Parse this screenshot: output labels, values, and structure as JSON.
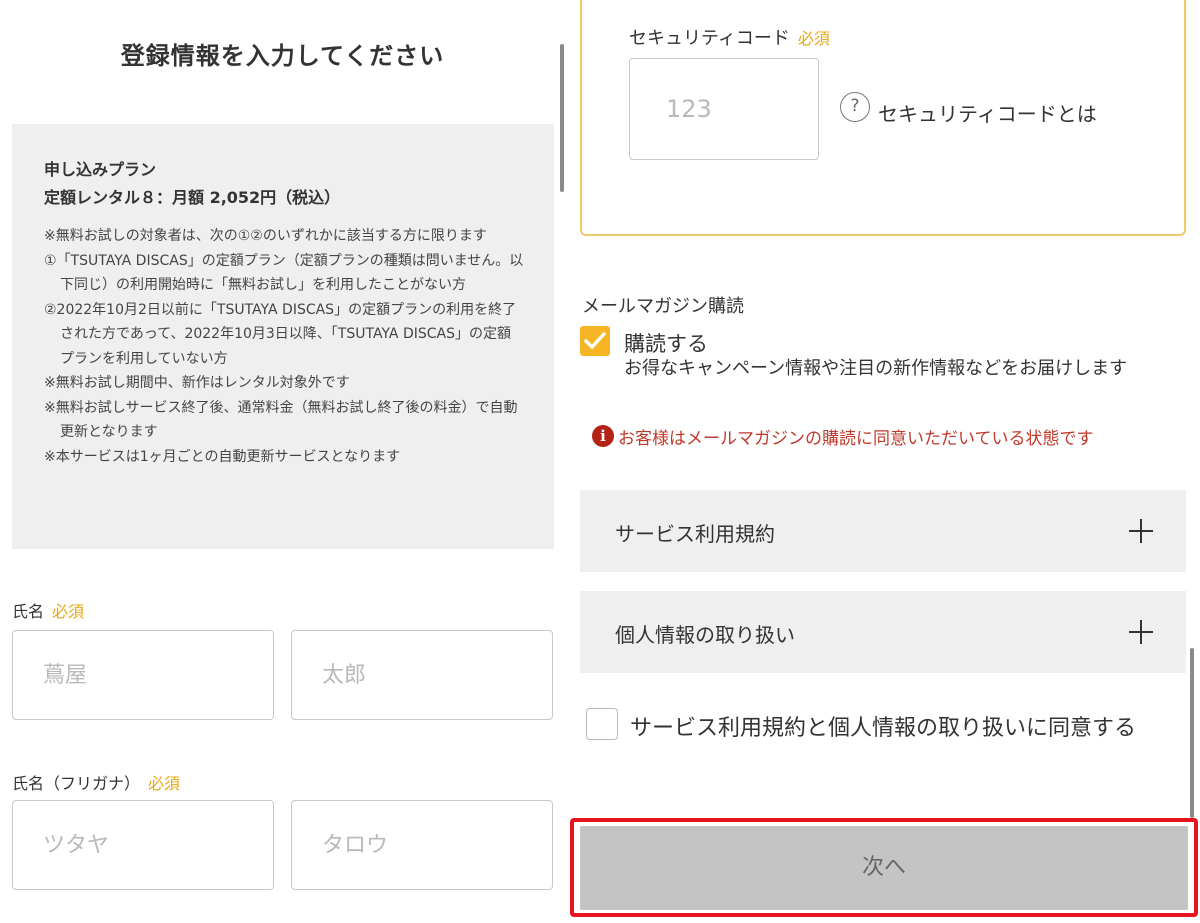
{
  "left": {
    "title": "登録情報を入力してください",
    "plan": {
      "label": "申し込みプラン",
      "price": "定額レンタル８：月額 2,052円（税込）",
      "notes": [
        "※無料お試しの対象者は、次の①②のいずれかに該当する方に限ります",
        "①「TSUTAYA DISCAS」の定額プラン（定額プランの種類は問いません。以下同じ）の利用開始時に「無料お試し」を利用したことがない方",
        "②2022年10月2日以前に「TSUTAYA DISCAS」の定額プランの利用を終了された方であって、2022年10月3日以降、「TSUTAYA DISCAS」の定額プランを利用していない方",
        "※無料お試し期間中、新作はレンタル対象外です",
        "※無料お試しサービス終了後、通常料金（無料お試し終了後の料金）で自動更新となります",
        "※本サービスは1ヶ月ごとの自動更新サービスとなります"
      ]
    },
    "name": {
      "label": "氏名",
      "required": "必須",
      "sei_placeholder": "蔦屋",
      "mei_placeholder": "太郎"
    },
    "kana": {
      "label": "氏名（フリガナ）",
      "required": "必須",
      "sei_placeholder": "ツタヤ",
      "mei_placeholder": "タロウ"
    }
  },
  "right": {
    "security": {
      "label": "セキュリティコード",
      "required": "必須",
      "placeholder": "123",
      "help_icon": "?",
      "help_link": "セキュリティコードとは"
    },
    "mail": {
      "heading": "メールマガジン購読",
      "checkbox_label": "購読する",
      "checked": true,
      "description": "お得なキャンペーン情報や注目の新作情報などをお届けします",
      "warning_icon": "i",
      "warning": "お客様はメールマガジンの購読に同意いただいている状態です"
    },
    "accordions": {
      "terms": "サービス利用規約",
      "privacy": "個人情報の取り扱い"
    },
    "agree_label": "サービス利用規約と個人情報の取り扱いに同意する",
    "next_label": "次へ"
  },
  "colors": {
    "required": "#e6a817",
    "checkbox": "#f5b524",
    "warning": "#c0392b",
    "highlight_outline": "#e8141d",
    "button_disabled": "#c4c4c4"
  }
}
